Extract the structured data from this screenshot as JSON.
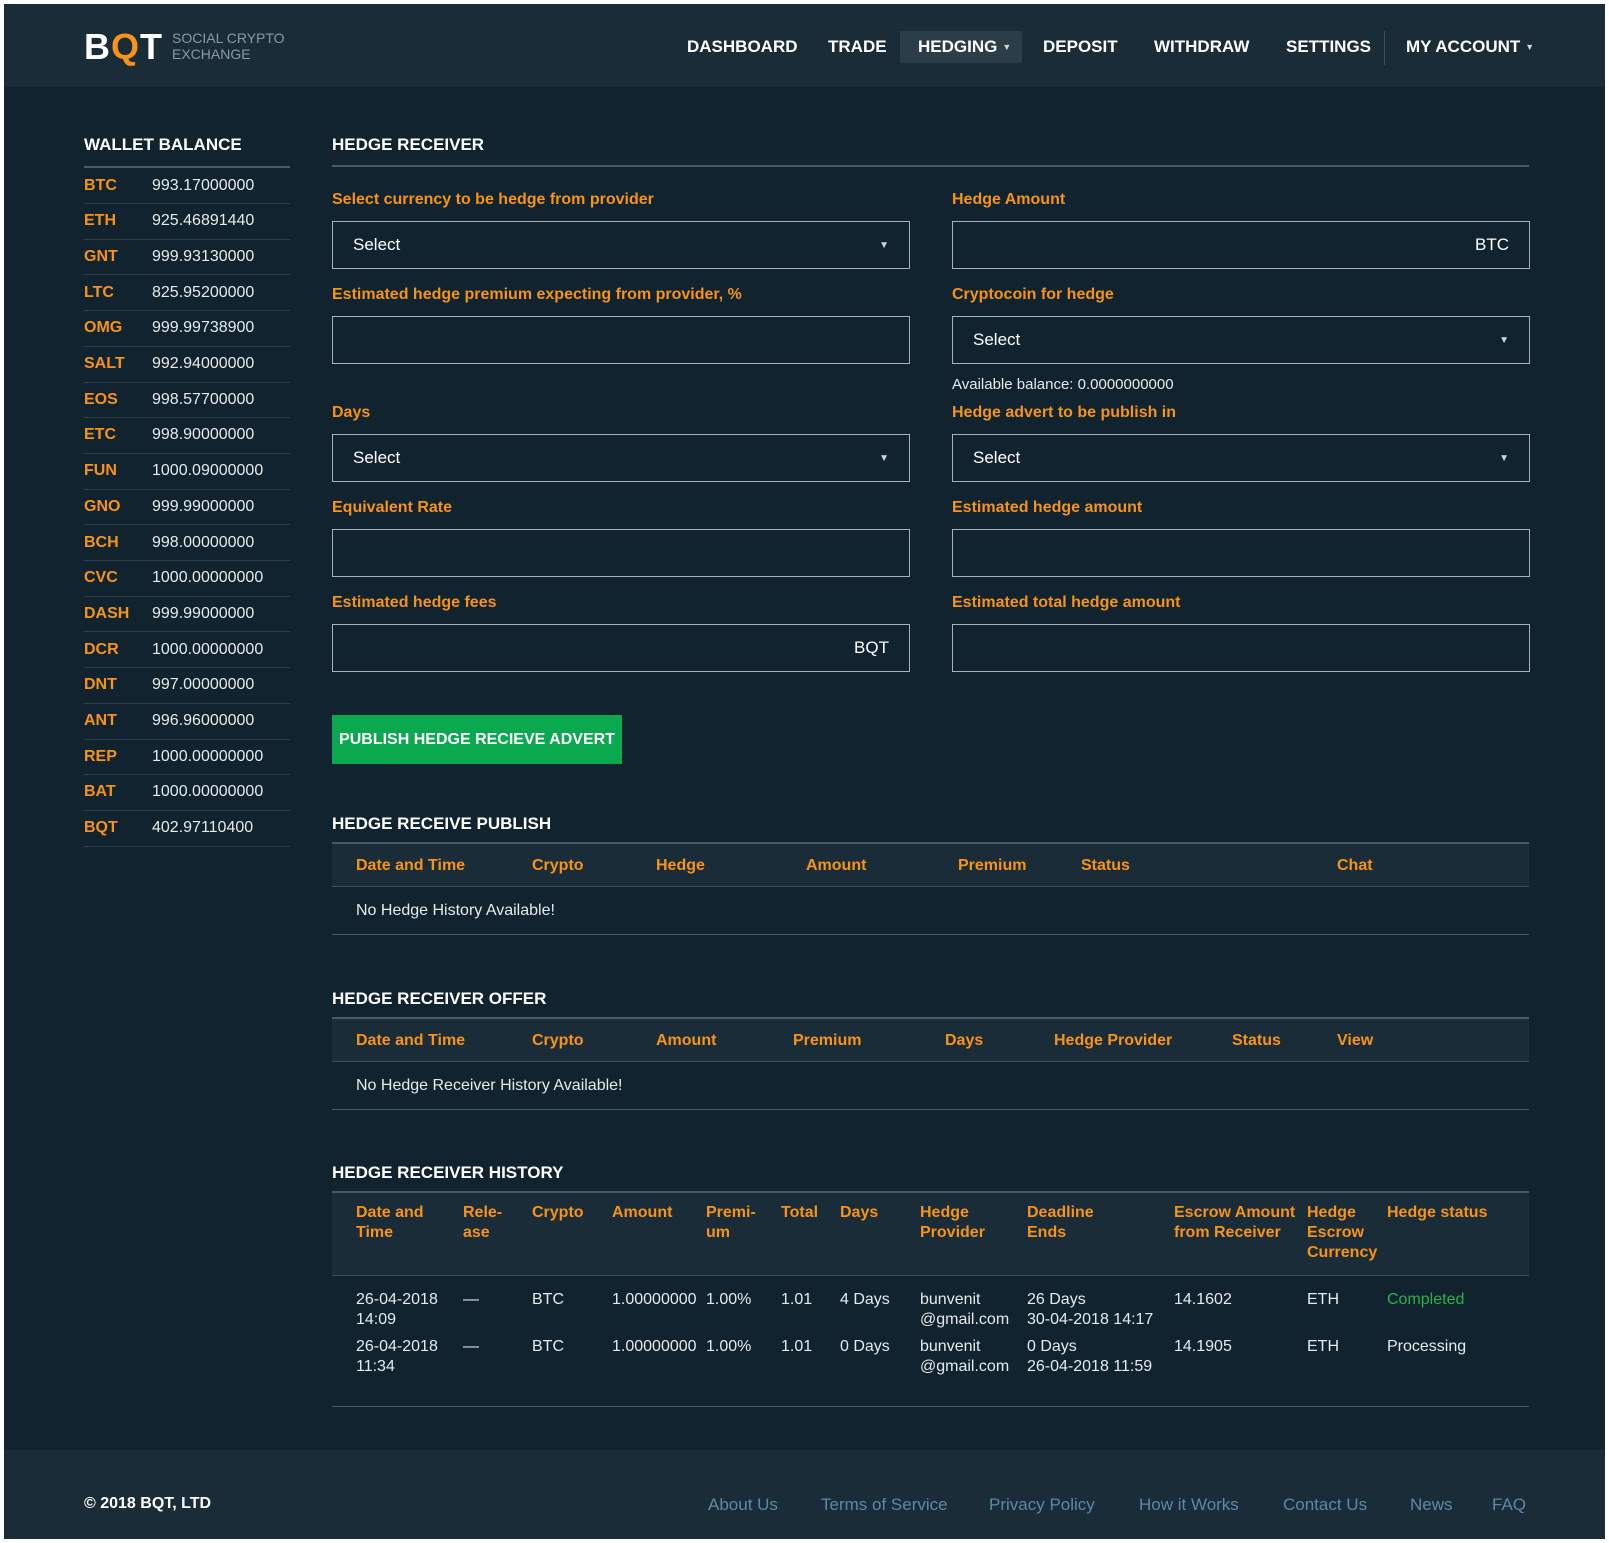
{
  "brand": {
    "logo_b": "B",
    "logo_q": "Q",
    "logo_t": "T",
    "tagline_1": "SOCIAL CRYPTO",
    "tagline_2": "EXCHANGE"
  },
  "nav": {
    "dashboard": "DASHBOARD",
    "trade": "TRADE",
    "hedging": "HEDGING",
    "deposit": "DEPOSIT",
    "withdraw": "WITHDRAW",
    "settings": "SETTINGS",
    "my_account": "MY ACCOUNT",
    "active": "hedging"
  },
  "wallet": {
    "title": "WALLET BALANCE",
    "items": [
      {
        "symbol": "BTC",
        "balance": "993.17000000"
      },
      {
        "symbol": "ETH",
        "balance": "925.46891440"
      },
      {
        "symbol": "GNT",
        "balance": "999.93130000"
      },
      {
        "symbol": "LTC",
        "balance": "825.95200000"
      },
      {
        "symbol": "OMG",
        "balance": "999.99738900"
      },
      {
        "symbol": "SALT",
        "balance": "992.94000000"
      },
      {
        "symbol": "EOS",
        "balance": "998.57700000"
      },
      {
        "symbol": "ETC",
        "balance": "998.90000000"
      },
      {
        "symbol": "FUN",
        "balance": "1000.09000000"
      },
      {
        "symbol": "GNO",
        "balance": "999.99000000"
      },
      {
        "symbol": "BCH",
        "balance": "998.00000000"
      },
      {
        "symbol": "CVC",
        "balance": "1000.00000000"
      },
      {
        "symbol": "DASH",
        "balance": "999.99000000"
      },
      {
        "symbol": "DCR",
        "balance": "1000.00000000"
      },
      {
        "symbol": "DNT",
        "balance": "997.00000000"
      },
      {
        "symbol": "ANT",
        "balance": "996.96000000"
      },
      {
        "symbol": "REP",
        "balance": "1000.00000000"
      },
      {
        "symbol": "BAT",
        "balance": "1000.00000000"
      },
      {
        "symbol": "BQT",
        "balance": "402.97110400"
      }
    ]
  },
  "form": {
    "title": "HEDGE RECEIVER",
    "currency_label": "Select currency to be hedge from provider",
    "currency_value": "Select",
    "hedge_amount_label": "Hedge Amount",
    "hedge_amount_suffix": "BTC",
    "premium_label": "Estimated hedge premium expecting from provider, %",
    "cryptocoin_label": "Cryptocoin for hedge",
    "cryptocoin_value": "Select",
    "available_balance": "Available balance: 0.0000000000",
    "days_label": "Days",
    "days_value": "Select",
    "advert_label": "Hedge advert to be publish in",
    "advert_value": "Select",
    "rate_label": "Equivalent Rate",
    "est_amount_label": "Estimated hedge amount",
    "fees_label": "Estimated hedge fees",
    "fees_suffix": "BQT",
    "total_label": "Estimated total hedge amount",
    "publish_button": "PUBLISH HEDGE RECIEVE ADVERT"
  },
  "publish_table": {
    "title": "HEDGE RECEIVE PUBLISH",
    "headers": [
      "Date and Time",
      "Crypto",
      "Hedge",
      "Amount",
      "Premium",
      "Status",
      "Chat"
    ],
    "empty": "No Hedge History Available!"
  },
  "offer_table": {
    "title": "HEDGE RECEIVER OFFER",
    "headers": [
      "Date and Time",
      "Crypto",
      "Amount",
      "Premium",
      "Days",
      "Hedge Provider",
      "Status",
      "View"
    ],
    "empty": "No Hedge Receiver History Available!"
  },
  "history_table": {
    "title": "HEDGE RECEIVER HISTORY",
    "headers": [
      [
        "Date and",
        "Time"
      ],
      [
        "Rele-",
        "ase"
      ],
      [
        "Crypto"
      ],
      [
        "Amount"
      ],
      [
        "Premi-",
        "um"
      ],
      [
        "Total"
      ],
      [
        "Days"
      ],
      [
        "Hedge",
        "Provider"
      ],
      [
        "Deadline",
        "Ends"
      ],
      [
        "Escrow Amount",
        "from Receiver"
      ],
      [
        "Hedge",
        "Escrow",
        "Currency"
      ],
      [
        "Hedge status"
      ]
    ],
    "rows": [
      {
        "date": "26-04-2018",
        "time": "14:09",
        "release": "—",
        "crypto": "BTC",
        "amount": "1.00000000",
        "premium": "1.00%",
        "total": "1.01",
        "days": "4 Days",
        "provider_1": "bunvenit",
        "provider_2": "@gmail.com",
        "deadline_1": "26 Days",
        "deadline_2": "30-04-2018 14:17",
        "escrow": "14.1602",
        "currency": "ETH",
        "status": "Completed"
      },
      {
        "date": "26-04-2018",
        "time": "11:34",
        "release": "—",
        "crypto": "BTC",
        "amount": "1.00000000",
        "premium": "1.00%",
        "total": "1.01",
        "days": "0 Days",
        "provider_1": "bunvenit",
        "provider_2": "@gmail.com",
        "deadline_1": "0 Days",
        "deadline_2": "26-04-2018 11:59",
        "escrow": "14.1905",
        "currency": "ETH",
        "status": "Processing"
      }
    ]
  },
  "footer": {
    "copyright": "© 2018 BQT, LTD",
    "links": [
      "About Us",
      "Terms of Service",
      "Privacy Policy",
      "How it Works",
      "Contact Us",
      "News",
      "FAQ"
    ]
  },
  "colors": {
    "background": "#10232f",
    "header": "#1a2c38",
    "accent": "#f7931a",
    "button": "#0aa84f",
    "status_completed": "#2bb34a",
    "footer_link": "#5a8aa3"
  }
}
